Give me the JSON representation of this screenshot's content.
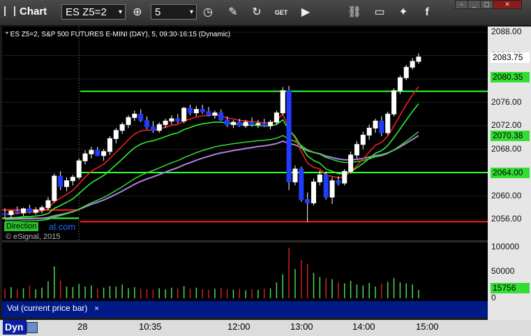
{
  "toolbar": {
    "title": "Chart",
    "symbol": "ES Z5=2",
    "interval": "5",
    "icons": [
      "crosshair-icon",
      "clock-icon",
      "pencil-icon",
      "refresh-icon",
      "get-icon",
      "play-icon",
      "link-icon",
      "chat-icon",
      "twitter-icon",
      "facebook-icon"
    ],
    "window_buttons": [
      "pin",
      "minimize",
      "restore",
      "close"
    ]
  },
  "chart": {
    "header": "* ES Z5=2, S&P 500 FUTURES E-MINI (DAY), 5, 09:30-16:15 (Dynamic)",
    "copyright": "© eSignal, 2015",
    "direction_label": "Direction",
    "watermark_suffix": "al.com",
    "y_ticks": [
      "2088.00",
      "2084.00",
      "2080.00",
      "2076.00",
      "2072.00",
      "2068.00",
      "2064.00",
      "2060.00",
      "2056.00"
    ],
    "price_labels": [
      {
        "value": "2083.75",
        "color": "#ffffff"
      },
      {
        "value": "2080.35",
        "color": "#33dd33"
      },
      {
        "value": "2070.38",
        "color": "#33dd33"
      },
      {
        "value": "2064.00",
        "color": "#33dd33"
      }
    ]
  },
  "volume": {
    "label": "Vol (current price bar)",
    "close_glyph": "×",
    "y_ticks": [
      "100000",
      "50000",
      "0"
    ],
    "current": "15756"
  },
  "x_axis": {
    "mode": "Dyn",
    "ticks": [
      "28",
      "10:35",
      "12:00",
      "13:00",
      "14:00",
      "15:00"
    ]
  },
  "chart_data": {
    "type": "candlestick",
    "yrange": [
      2054,
      2090
    ],
    "levels": [
      {
        "name": "green-upper",
        "value": 2077.9,
        "color": "#33ff33"
      },
      {
        "name": "green-lower",
        "value": 2064.0,
        "color": "#33ff33"
      },
      {
        "name": "red-lower",
        "value": 2055.6,
        "color": "#ff2020"
      }
    ],
    "candles": [
      [
        2057.0,
        2057.9,
        2056.2,
        2056.8
      ],
      [
        2056.8,
        2057.6,
        2056.2,
        2057.4
      ],
      [
        2057.4,
        2058.2,
        2056.9,
        2057.1
      ],
      [
        2057.1,
        2058.0,
        2056.6,
        2057.8
      ],
      [
        2057.8,
        2058.5,
        2057.0,
        2057.2
      ],
      [
        2057.2,
        2058.1,
        2056.8,
        2057.6
      ],
      [
        2057.6,
        2058.4,
        2057.0,
        2058.0
      ],
      [
        2058.0,
        2059.8,
        2057.6,
        2059.2
      ],
      [
        2059.2,
        2063.8,
        2058.8,
        2063.4
      ],
      [
        2063.4,
        2064.2,
        2061.0,
        2061.6
      ],
      [
        2061.6,
        2063.2,
        2060.8,
        2062.6
      ],
      [
        2062.6,
        2063.6,
        2061.8,
        2063.2
      ],
      [
        2063.2,
        2066.4,
        2062.8,
        2066.0
      ],
      [
        2066.0,
        2067.8,
        2065.4,
        2067.2
      ],
      [
        2067.2,
        2068.4,
        2066.4,
        2067.8
      ],
      [
        2067.8,
        2068.4,
        2066.8,
        2066.9
      ],
      [
        2066.9,
        2068.0,
        2066.0,
        2067.6
      ],
      [
        2067.6,
        2070.2,
        2067.0,
        2069.8
      ],
      [
        2069.8,
        2071.6,
        2069.0,
        2071.2
      ],
      [
        2071.2,
        2072.6,
        2070.6,
        2072.2
      ],
      [
        2072.2,
        2073.8,
        2071.6,
        2073.4
      ],
      [
        2073.4,
        2074.6,
        2072.8,
        2074.0
      ],
      [
        2074.0,
        2074.8,
        2072.6,
        2072.9
      ],
      [
        2072.9,
        2073.6,
        2071.4,
        2071.8
      ],
      [
        2071.8,
        2072.8,
        2070.8,
        2071.2
      ],
      [
        2071.2,
        2072.6,
        2070.8,
        2072.2
      ],
      [
        2072.2,
        2073.2,
        2071.6,
        2072.8
      ],
      [
        2072.8,
        2073.8,
        2072.2,
        2073.2
      ],
      [
        2073.2,
        2074.0,
        2072.4,
        2072.8
      ],
      [
        2072.8,
        2075.2,
        2072.4,
        2075.0
      ],
      [
        2075.0,
        2075.6,
        2073.8,
        2074.2
      ],
      [
        2074.2,
        2075.4,
        2073.6,
        2074.8
      ],
      [
        2074.8,
        2075.6,
        2074.0,
        2074.4
      ],
      [
        2074.4,
        2075.2,
        2073.6,
        2073.8
      ],
      [
        2073.8,
        2074.6,
        2073.2,
        2074.2
      ],
      [
        2074.2,
        2074.8,
        2072.8,
        2073.0
      ],
      [
        2073.0,
        2073.6,
        2071.8,
        2072.2
      ],
      [
        2072.2,
        2073.0,
        2071.6,
        2072.6
      ],
      [
        2072.6,
        2073.2,
        2071.8,
        2072.0
      ],
      [
        2072.0,
        2073.0,
        2071.6,
        2072.6
      ],
      [
        2072.6,
        2073.4,
        2071.8,
        2072.2
      ],
      [
        2072.2,
        2073.0,
        2071.6,
        2072.4
      ],
      [
        2072.4,
        2073.2,
        2071.8,
        2072.0
      ],
      [
        2072.0,
        2073.0,
        2071.4,
        2072.6
      ],
      [
        2072.6,
        2074.6,
        2072.2,
        2074.2
      ],
      [
        2074.2,
        2078.6,
        2073.8,
        2078.0
      ],
      [
        2078.0,
        2078.8,
        2061.0,
        2062.4
      ],
      [
        2062.4,
        2065.2,
        2061.8,
        2064.6
      ],
      [
        2064.6,
        2065.0,
        2059.0,
        2059.4
      ],
      [
        2059.4,
        2060.6,
        2055.6,
        2058.8
      ],
      [
        2058.8,
        2063.0,
        2058.4,
        2062.4
      ],
      [
        2062.4,
        2064.4,
        2061.8,
        2063.6
      ],
      [
        2063.6,
        2064.2,
        2059.4,
        2059.8
      ],
      [
        2059.8,
        2063.2,
        2058.6,
        2062.6
      ],
      [
        2062.6,
        2063.4,
        2061.8,
        2062.2
      ],
      [
        2062.2,
        2064.6,
        2061.8,
        2064.2
      ],
      [
        2064.2,
        2067.6,
        2063.8,
        2067.0
      ],
      [
        2067.0,
        2069.4,
        2066.4,
        2068.8
      ],
      [
        2068.8,
        2071.0,
        2068.0,
        2070.4
      ],
      [
        2070.4,
        2072.2,
        2069.6,
        2071.6
      ],
      [
        2071.6,
        2073.2,
        2070.8,
        2072.8
      ],
      [
        2072.8,
        2073.6,
        2070.2,
        2070.8
      ],
      [
        2070.8,
        2074.4,
        2070.4,
        2074.0
      ],
      [
        2074.0,
        2078.4,
        2073.6,
        2078.0
      ],
      [
        2078.0,
        2080.6,
        2077.4,
        2080.2
      ],
      [
        2080.2,
        2082.4,
        2079.8,
        2082.0
      ],
      [
        2082.0,
        2083.6,
        2081.6,
        2083.0
      ],
      [
        2083.0,
        2084.4,
        2082.6,
        2083.75
      ]
    ],
    "volume": [
      18000,
      21000,
      16000,
      19000,
      24000,
      17000,
      20000,
      32000,
      60000,
      33000,
      22000,
      21000,
      27000,
      22000,
      24000,
      18000,
      20000,
      23000,
      22000,
      26000,
      19000,
      21000,
      18000,
      17000,
      16000,
      19000,
      17000,
      20000,
      18000,
      23000,
      18000,
      20000,
      17000,
      16000,
      18000,
      19000,
      17000,
      16000,
      18000,
      15000,
      17000,
      16000,
      18000,
      19000,
      30000,
      45000,
      95000,
      55000,
      72000,
      65000,
      48000,
      40000,
      38000,
      36000,
      30000,
      28000,
      33000,
      26000,
      24000,
      29000,
      22000,
      27000,
      31000,
      38000,
      30000,
      28000,
      26000,
      15756
    ]
  }
}
